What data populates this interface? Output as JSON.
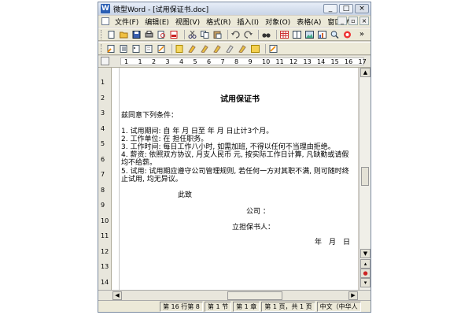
{
  "window": {
    "app_icon_letter": "W",
    "title": "微型Word - [试用保证书.doc]",
    "controls": {
      "minimize": "_",
      "maximize": "□",
      "close": "×"
    }
  },
  "menubar": {
    "items": [
      "文件(F)",
      "编辑(E)",
      "视图(V)",
      "格式(R)",
      "插入(I)",
      "对象(O)",
      "表格(A)",
      "窗口(W)"
    ],
    "right_controls": [
      "_",
      "▫",
      "×"
    ]
  },
  "toolbar1": {
    "icons": [
      "new-doc-icon",
      "open-icon",
      "save-icon",
      "print-icon",
      "print-preview-icon",
      "pdf-icon",
      "cut-icon",
      "copy-icon",
      "paste-icon",
      "undo-icon",
      "redo-icon",
      "find-icon",
      "table-icon",
      "columns-icon",
      "image-icon",
      "chart-icon",
      "zoom-icon",
      "help-icon"
    ],
    "overflow": "»"
  },
  "toolbar2": {
    "icons": [
      "align-icon",
      "indent-icon",
      "bullets-icon",
      "numbering-icon",
      "style-icon",
      "font-icon",
      "highlight-icon",
      "marker-icon",
      "marker-icon",
      "marker-icon",
      "marker-icon",
      "border-icon",
      "eraser-icon"
    ]
  },
  "ruler": {
    "h_numbers": [
      "1",
      "1",
      "2",
      "3",
      "4",
      "5",
      "6",
      "7",
      "8",
      "9",
      "10",
      "11",
      "12",
      "13",
      "14",
      "15",
      "16",
      "17"
    ],
    "v_numbers": [
      "1",
      "2",
      "3",
      "4",
      "5",
      "6",
      "7",
      "8",
      "9",
      "10",
      "11",
      "12",
      "13",
      "14"
    ]
  },
  "document": {
    "title": "试用保证书",
    "intro": "兹同意下列条件：",
    "items": [
      "1.  试用期间: 自 年 月 日至 年 月 日止计3个月。",
      "2.  工作单位: 在 担任职务。",
      "3.  工作时间: 每日工作八小时, 如需加班, 不得以任何不当理由拒绝。",
      "4.  薪资: 依照双方协议, 月支人民币 元, 按实际工作日计算, 凡缺勤或请假",
      "     均不给薪。",
      "5.  试用: 试用期应遵守公司管理规则, 若任何一方对其职不满, 则可随时终",
      "     止试用, 均无异议。"
    ],
    "closing": "此致",
    "company": "公司 ：",
    "guarantor": "立担保书人：",
    "date": "年　月　日"
  },
  "scrollbar": {
    "up": "▲",
    "down": "▼",
    "prev_page": "▴",
    "browse": "●",
    "next_page": "▾",
    "left": "◀",
    "right": "▶"
  },
  "statusbar": {
    "cells": [
      "第 16 行第 8",
      "第 1 节",
      "第 1 章",
      "第 1 页，共 1 页",
      "中文（中华人"
    ]
  },
  "colors": {
    "app_icon": "#2b5fb4",
    "title_bar": "#c8d4e6",
    "chrome": "#ece9d8"
  }
}
